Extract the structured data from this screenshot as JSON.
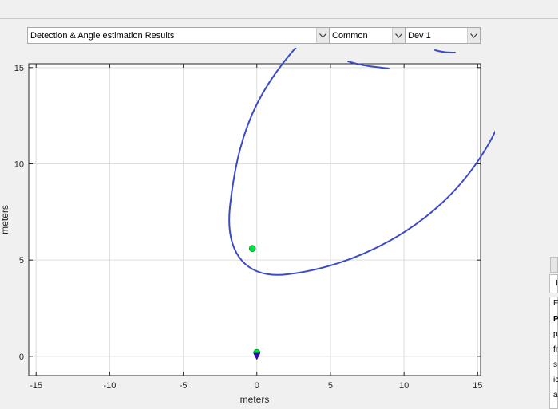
{
  "dropdowns": {
    "view": {
      "value": "Detection & Angle estimation Results"
    },
    "mode": {
      "value": "Common"
    },
    "device": {
      "value": "Dev 1"
    }
  },
  "side_panel": {
    "cells": [
      "P",
      "p",
      "fr",
      "s",
      "ic",
      "a"
    ],
    "tab_label": "I",
    "header_label": "F"
  },
  "chart_data": {
    "type": "scatter",
    "xlabel": "meters",
    "ylabel": "meters",
    "xlim": [
      -15.5,
      15.2
    ],
    "ylim": [
      -1.0,
      15.2
    ],
    "xticks": [
      -15,
      -10,
      -5,
      0,
      5,
      10,
      15
    ],
    "yticks": [
      0,
      5,
      10,
      15
    ],
    "grid": true,
    "points": [
      {
        "x": -0.3,
        "y": 5.6,
        "color": "#00e040",
        "marker": "circle"
      },
      {
        "x": 0.0,
        "y": 0.2,
        "color": "#00e040",
        "marker": "circle"
      },
      {
        "x": 0.0,
        "y": 0.0,
        "color": "#3a00c8",
        "marker": "triangle-down"
      }
    ],
    "annotation_color": "#3b4bc8"
  }
}
